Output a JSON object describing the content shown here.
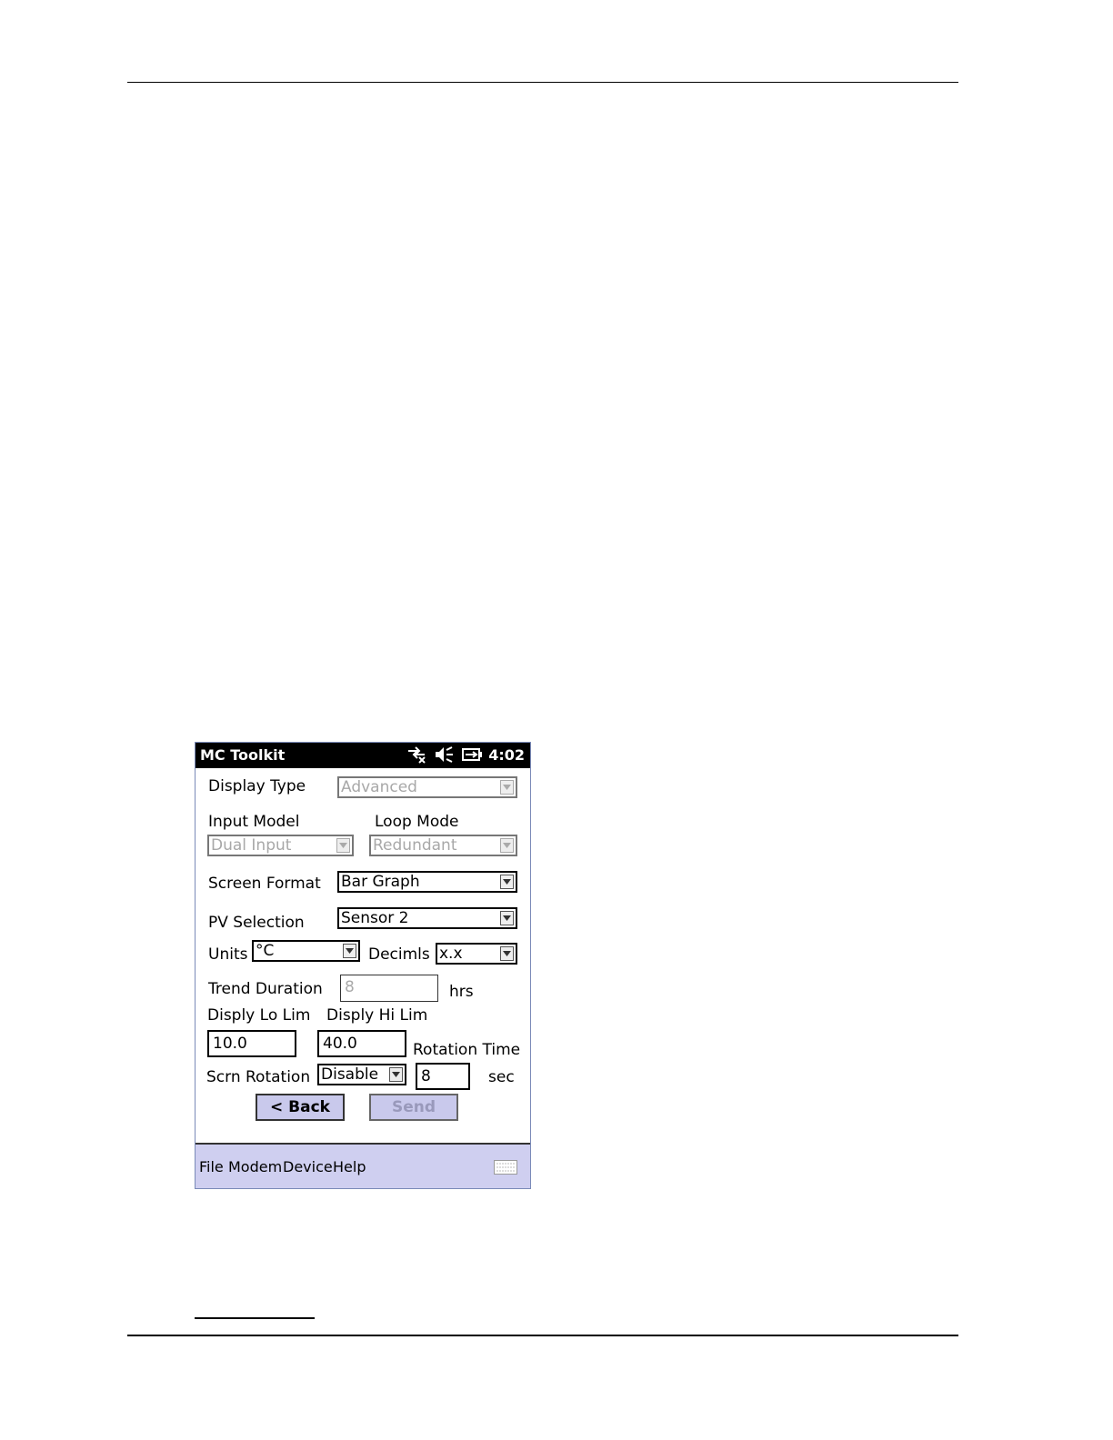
{
  "app": {
    "title": "MC Toolkit",
    "clock": "4:02"
  },
  "status_icons": [
    "connectivity-icon",
    "speaker-muted-icon",
    "battery-icon"
  ],
  "form": {
    "display_type": {
      "label": "Display Type",
      "value": "Advanced"
    },
    "input_model": {
      "label": "Input Model",
      "value": "Dual Input"
    },
    "loop_mode": {
      "label": "Loop Mode",
      "value": "Redundant"
    },
    "screen_format": {
      "label": "Screen Format",
      "value": "Bar Graph"
    },
    "pv_selection": {
      "label": "PV Selection",
      "value": "Sensor 2"
    },
    "units": {
      "label": "Units",
      "value": "°C"
    },
    "decimals": {
      "label": "Decimls",
      "value": "x.x"
    },
    "trend_duration": {
      "label": "Trend Duration",
      "value": "8",
      "unit": "hrs"
    },
    "display_lo_limit": {
      "label": "Disply Lo Lim",
      "value": "10.0"
    },
    "display_hi_limit": {
      "label": "Disply Hi Lim",
      "value": "40.0"
    },
    "rotation_time": {
      "label": "Rotation Time",
      "value": "8",
      "unit": "sec"
    },
    "screen_rotation": {
      "label": "Scrn Rotation",
      "value": "Disable"
    }
  },
  "buttons": {
    "back": "< Back",
    "send": "Send"
  },
  "menu": [
    "File",
    "Modem",
    "Device",
    "Help"
  ]
}
